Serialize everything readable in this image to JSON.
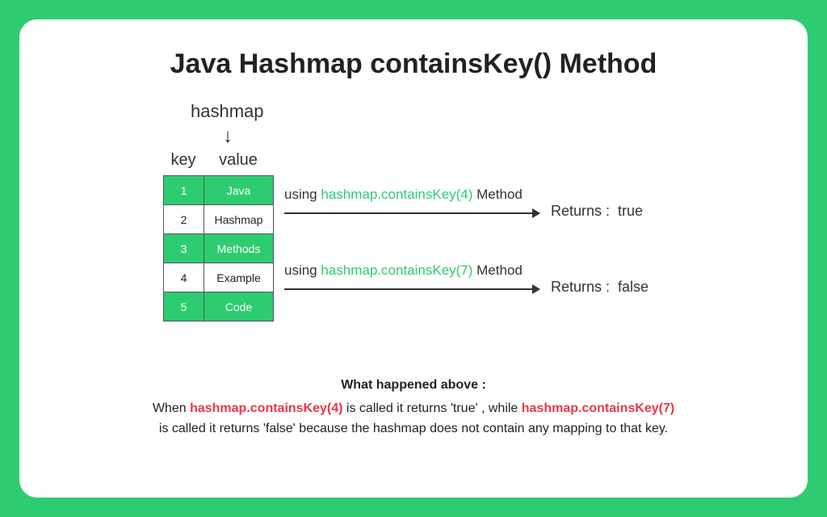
{
  "title": "Java Hashmap containsKey() Method",
  "diagram": {
    "hashmap_label": "hashmap",
    "col_key": "key",
    "col_value": "value",
    "rows": [
      {
        "key": "1",
        "value": "Java"
      },
      {
        "key": "2",
        "value": "Hashmap"
      },
      {
        "key": "3",
        "value": "Methods"
      },
      {
        "key": "4",
        "value": "Example"
      },
      {
        "key": "5",
        "value": "Code"
      }
    ],
    "call1": {
      "prefix": "using ",
      "code": "hashmap.containsKey(4)",
      "suffix": " Method",
      "returns_label": "Returns :",
      "returns_value": "true"
    },
    "call2": {
      "prefix": "using ",
      "code": "hashmap.containsKey(7)",
      "suffix": " Method",
      "returns_label": "Returns :",
      "returns_value": "false"
    }
  },
  "explanation": {
    "heading": "What happened above :",
    "p1a": "When ",
    "p1code": "hashmap.containsKey(4)",
    "p1b": " is called it returns 'true' , while ",
    "p2code": "hashmap.containsKey(7)",
    "p2a": "is called it returns 'false' because the hashmap does not contain any mapping to that key."
  }
}
